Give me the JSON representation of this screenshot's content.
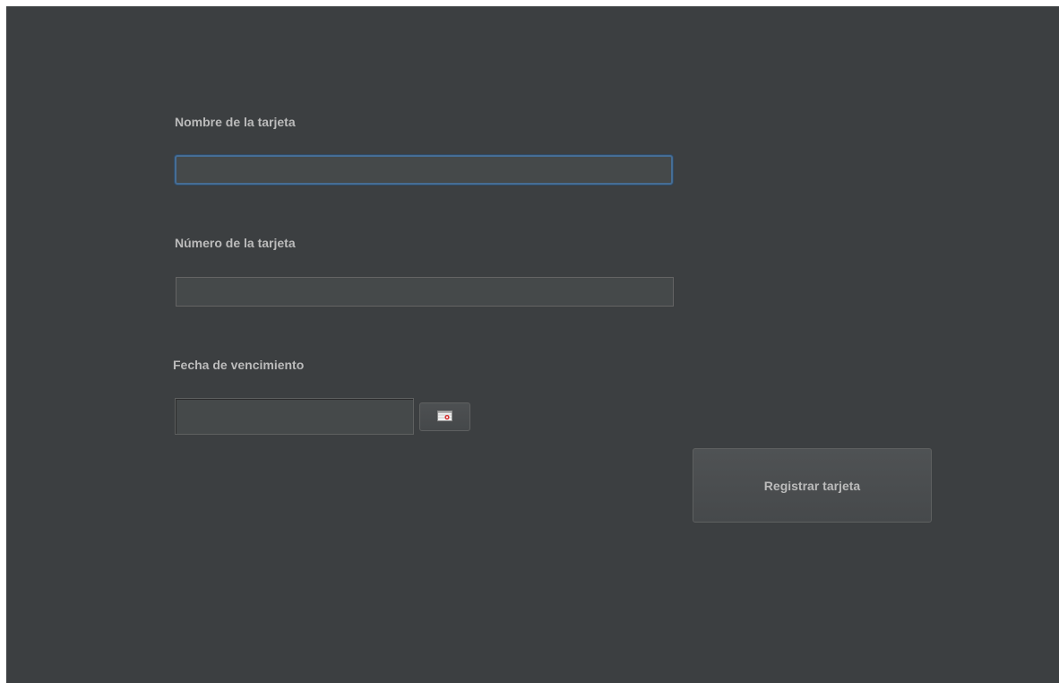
{
  "form": {
    "card_name": {
      "label": "Nombre de la tarjeta",
      "value": ""
    },
    "card_number": {
      "label": "Número de la tarjeta",
      "value": ""
    },
    "expiry_date": {
      "label": "Fecha de vencimiento",
      "value": "",
      "picker_icon": "calendar-icon"
    },
    "submit_label": "Registrar tarjeta"
  },
  "colors": {
    "background": "#3c3f41",
    "field_background": "#45494a",
    "focus_border": "#466d94",
    "text": "#bbbbbb"
  }
}
